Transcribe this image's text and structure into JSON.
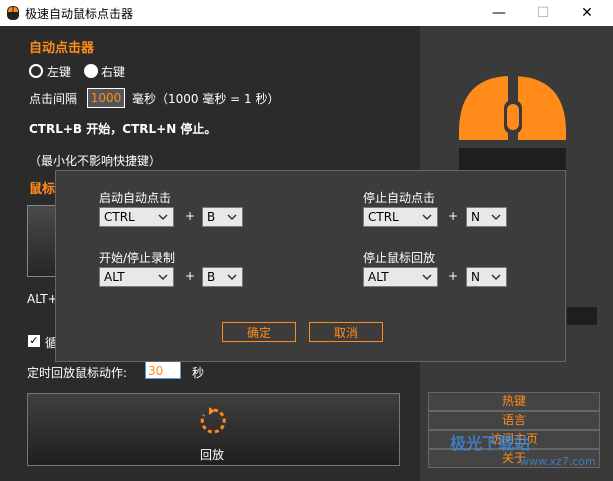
{
  "window": {
    "title": "极速自动鼠标点击器",
    "minimize": "—",
    "maximize": "☐",
    "close": "✕"
  },
  "autoclick": {
    "section_title": "自动点击器",
    "left_key": "左键",
    "right_key": "右键",
    "interval_label": "点击间隔",
    "interval_value": "1000",
    "interval_unit": "毫秒（1000 毫秒 = 1 秒）",
    "shortcut_hint": "CTRL+B 开始，CTRL+N 停止。",
    "minimize_note": "（最小化不影响快捷键）"
  },
  "mouse_record": {
    "section_title_partial": "鼠标",
    "alt_hint_partial": "ALT+",
    "checkbox_label_partial": "循",
    "timer_label": "定时回放鼠标动作:",
    "timer_value": "30",
    "timer_unit": "秒",
    "playback_label": "回放"
  },
  "right_panel": {
    "links": [
      "热键",
      "语言",
      "访问主页",
      "关于"
    ]
  },
  "dialog": {
    "start_auto_label": "启动自动点击",
    "stop_auto_label": "停止自动点击",
    "start_stop_record_label": "开始/停止录制",
    "stop_playback_label": "停止鼠标回放",
    "start_auto_mod": "CTRL",
    "start_auto_key": "B",
    "stop_auto_mod": "CTRL",
    "stop_auto_key": "N",
    "record_mod": "ALT",
    "record_key": "B",
    "playback_mod": "ALT",
    "playback_key": "N",
    "plus": "+",
    "ok": "确定",
    "cancel": "取消"
  },
  "watermark": {
    "text": "极光下载站",
    "url": "www.xz7.com"
  },
  "colors": {
    "accent": "#ff8c1a",
    "background": "#2b2b2b",
    "dialog": "#3c3c3c"
  }
}
